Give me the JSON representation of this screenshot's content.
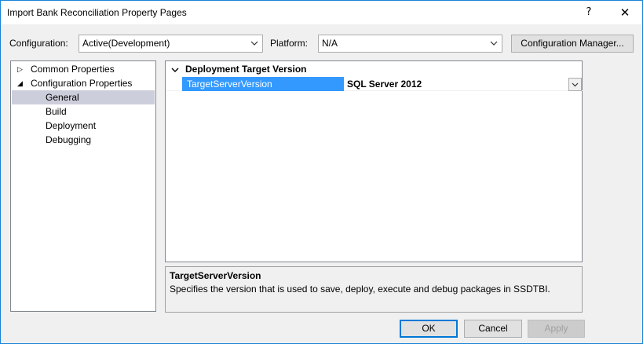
{
  "window": {
    "title": "Import Bank Reconciliation Property Pages",
    "help_glyph": "?",
    "close_glyph": "✕"
  },
  "toolbar": {
    "configuration_label": "Configuration:",
    "configuration_value": "Active(Development)",
    "platform_label": "Platform:",
    "platform_value": "N/A",
    "config_manager_label": "Configuration Manager..."
  },
  "tree": {
    "items": [
      {
        "label": "Common Properties",
        "expander": "▷",
        "level": 0
      },
      {
        "label": "Configuration Properties",
        "expander": "◢",
        "level": 0
      },
      {
        "label": "General",
        "level": 1,
        "selected": true
      },
      {
        "label": "Build",
        "level": 1
      },
      {
        "label": "Deployment",
        "level": 1
      },
      {
        "label": "Debugging",
        "level": 1
      }
    ]
  },
  "grid": {
    "category": "Deployment Target Version",
    "properties": [
      {
        "name": "TargetServerVersion",
        "value": "SQL Server 2012"
      }
    ]
  },
  "description": {
    "title": "TargetServerVersion",
    "text": "Specifies the version that is used to save, deploy, execute and debug packages in SSDTBI."
  },
  "footer": {
    "ok_label": "OK",
    "cancel_label": "Cancel",
    "apply_label": "Apply"
  },
  "colors": {
    "accent": "#1883d7",
    "selection": "#3399ff",
    "tree_selection": "#cccedb"
  }
}
